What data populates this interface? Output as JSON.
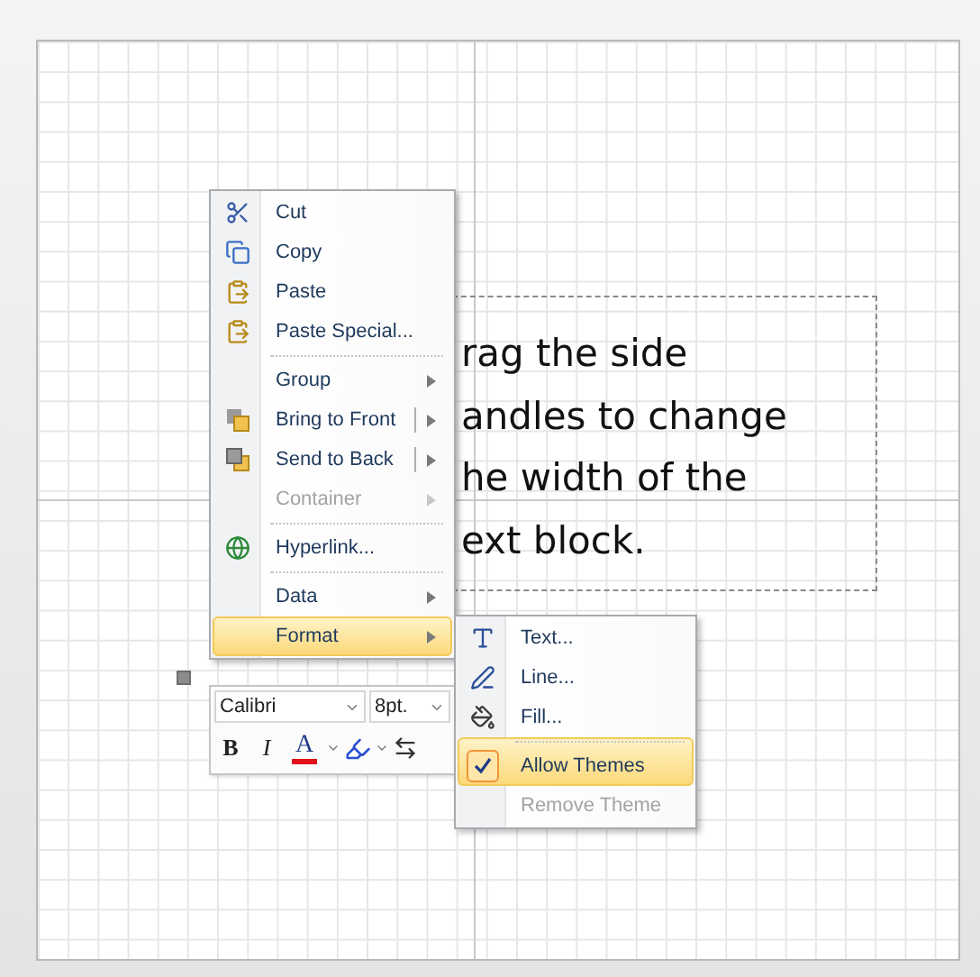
{
  "text_block": {
    "lines": [
      "rag the side",
      "andles to change",
      "he width of the",
      "ext block."
    ]
  },
  "context_menu": {
    "items": [
      {
        "label": "Cut",
        "disabled": false,
        "submenu": false,
        "split": false,
        "selected": false,
        "separator_before": false
      },
      {
        "label": "Copy",
        "disabled": false,
        "submenu": false,
        "split": false,
        "selected": false,
        "separator_before": false
      },
      {
        "label": "Paste",
        "disabled": false,
        "submenu": false,
        "split": false,
        "selected": false,
        "separator_before": false
      },
      {
        "label": "Paste Special...",
        "disabled": false,
        "submenu": false,
        "split": false,
        "selected": false,
        "separator_before": false
      },
      {
        "label": "Group",
        "disabled": false,
        "submenu": true,
        "split": false,
        "selected": false,
        "separator_before": true
      },
      {
        "label": "Bring to Front",
        "disabled": false,
        "submenu": true,
        "split": true,
        "selected": false,
        "separator_before": false
      },
      {
        "label": "Send to Back",
        "disabled": false,
        "submenu": true,
        "split": true,
        "selected": false,
        "separator_before": false
      },
      {
        "label": "Container",
        "disabled": true,
        "submenu": true,
        "split": false,
        "selected": false,
        "separator_before": false
      },
      {
        "label": "Hyperlink...",
        "disabled": false,
        "submenu": false,
        "split": false,
        "selected": false,
        "separator_before": true
      },
      {
        "label": "Data",
        "disabled": false,
        "submenu": true,
        "split": false,
        "selected": false,
        "separator_before": true
      },
      {
        "label": "Format",
        "disabled": false,
        "submenu": true,
        "split": false,
        "selected": true,
        "separator_before": false
      }
    ]
  },
  "mini_toolbar": {
    "font": "Calibri",
    "size": "8pt.",
    "bold": "B",
    "italic": "I",
    "font_color": "A"
  },
  "format_submenu": {
    "items": [
      {
        "label": "Text...",
        "disabled": false,
        "checked": false,
        "selected": false,
        "separator_before": false
      },
      {
        "label": "Line...",
        "disabled": false,
        "checked": false,
        "selected": false,
        "separator_before": false
      },
      {
        "label": "Fill...",
        "disabled": false,
        "checked": false,
        "selected": false,
        "separator_before": false
      },
      {
        "label": "Allow Themes",
        "disabled": false,
        "checked": true,
        "selected": true,
        "separator_before": true
      },
      {
        "label": "Remove Theme",
        "disabled": true,
        "checked": false,
        "selected": false,
        "separator_before": false
      }
    ]
  }
}
